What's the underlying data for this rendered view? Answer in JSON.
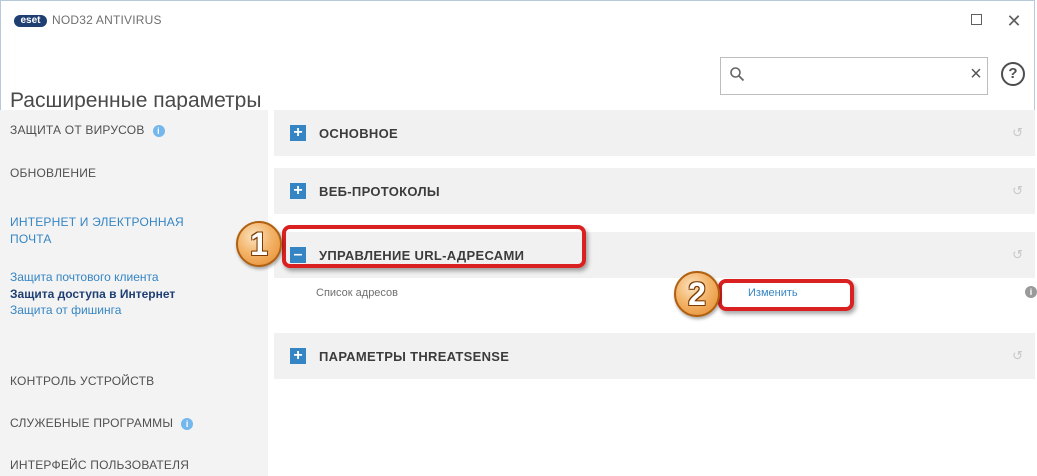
{
  "window": {
    "logo_text": "eset",
    "app_name": "NOD32 ANTIVIRUS"
  },
  "header": {
    "title": "Расширенные параметры",
    "search": {
      "value": "",
      "placeholder": ""
    }
  },
  "sidebar": {
    "items": [
      {
        "label": "ЗАЩИТА ОТ ВИРУСОВ",
        "info": "i"
      },
      {
        "label": "ОБНОВЛЕНИЕ"
      },
      {
        "label_line1": "ИНТЕРНЕТ И ЭЛЕКТРОННАЯ",
        "label_line2": "ПОЧТА"
      },
      {
        "label": "Защита почтового клиента"
      },
      {
        "label": "Защита доступа в Интернет"
      },
      {
        "label": "Защита от фишинга"
      },
      {
        "label": "КОНТРОЛЬ УСТРОЙСТВ"
      },
      {
        "label": "СЛУЖЕБНЫЕ ПРОГРАММЫ",
        "info": "i"
      },
      {
        "label": "ИНТЕРФЕЙС ПОЛЬЗОВАТЕЛЯ"
      }
    ]
  },
  "sections": [
    {
      "label": "ОСНОВНОЕ",
      "state": "+"
    },
    {
      "label": "ВЕБ-ПРОТОКОЛЫ",
      "state": "+"
    },
    {
      "label": "УПРАВЛЕНИЕ URL-АДРЕСАМИ",
      "state": "–"
    },
    {
      "label": "ПАРАМЕТРЫ THREATSENSE",
      "state": "+"
    }
  ],
  "url_settings": {
    "label": "Список адресов",
    "action": "Изменить",
    "info": "i"
  },
  "annotations": {
    "marker1": "1",
    "marker2": "2"
  },
  "colors": {
    "accent": "#3585c4",
    "highlight": "#d92121",
    "sidebar_bg": "#f3f3f3",
    "section_bg": "#f1f1f1"
  }
}
